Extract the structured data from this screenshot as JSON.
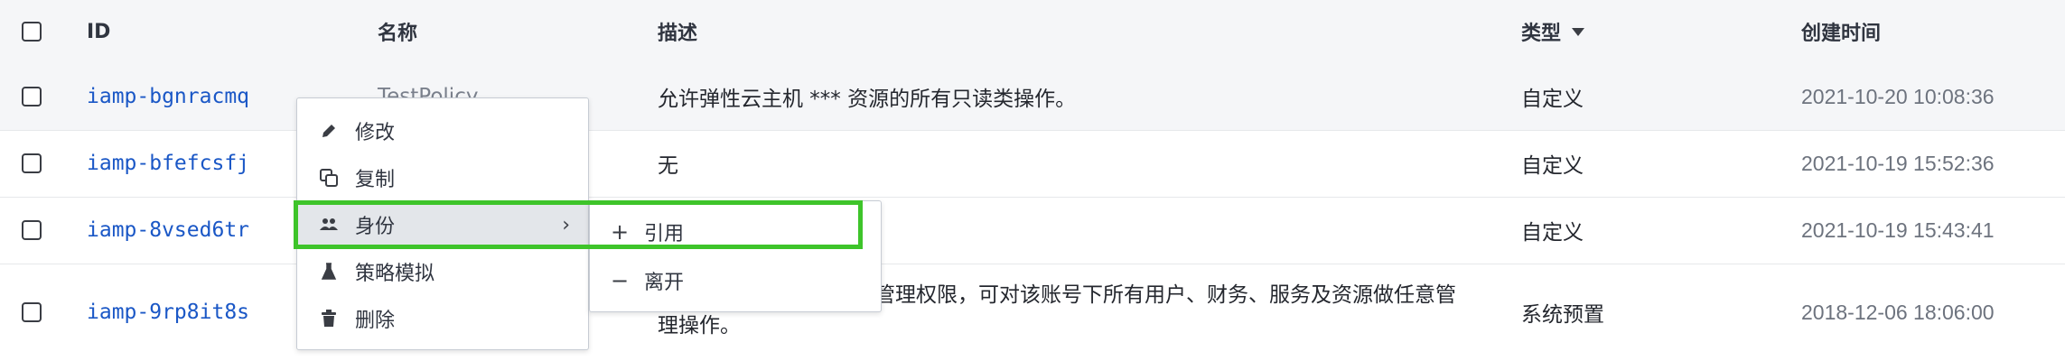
{
  "table": {
    "headers": {
      "id": "ID",
      "name": "名称",
      "description": "描述",
      "type": "类型",
      "created_at": "创建时间"
    },
    "rows": [
      {
        "id": "iamp-bgnracmq",
        "name": "TestPolicy",
        "description": "允许弹性云主机 *** 资源的所有只读类操作。",
        "type": "自定义",
        "created_at": "2021-10-20 10:08:36"
      },
      {
        "id": "iamp-bfefcsfj",
        "name": "",
        "description": "无",
        "type": "自定义",
        "created_at": "2021-10-19 15:52:36"
      },
      {
        "id": "iamp-8vsed6tr",
        "name": "",
        "description": "",
        "type": "自定义",
        "created_at": "2021-10-19 15:43:41"
      },
      {
        "id": "iamp-9rp8it8s",
        "name": "",
        "description_line1": "管理权限，可对该账号下所有用户、财务、服务及资源做任意管",
        "description_line2": "理操作。",
        "type": "系统预置",
        "created_at": "2018-12-06 18:06:00"
      }
    ]
  },
  "context_menu": {
    "items": [
      {
        "label": "修改",
        "icon": "pencil-icon"
      },
      {
        "label": "复制",
        "icon": "copy-icon"
      },
      {
        "label": "身份",
        "icon": "users-icon",
        "has_submenu": true
      },
      {
        "label": "策略模拟",
        "icon": "flask-icon"
      },
      {
        "label": "删除",
        "icon": "trash-icon"
      }
    ]
  },
  "submenu": {
    "items": [
      {
        "label": "引用",
        "icon": "plus-icon"
      },
      {
        "label": "离开",
        "icon": "minus-icon"
      }
    ]
  },
  "colors": {
    "link": "#1a57c6",
    "highlight": "#3ec42a",
    "header_bg": "#f5f6f8"
  }
}
